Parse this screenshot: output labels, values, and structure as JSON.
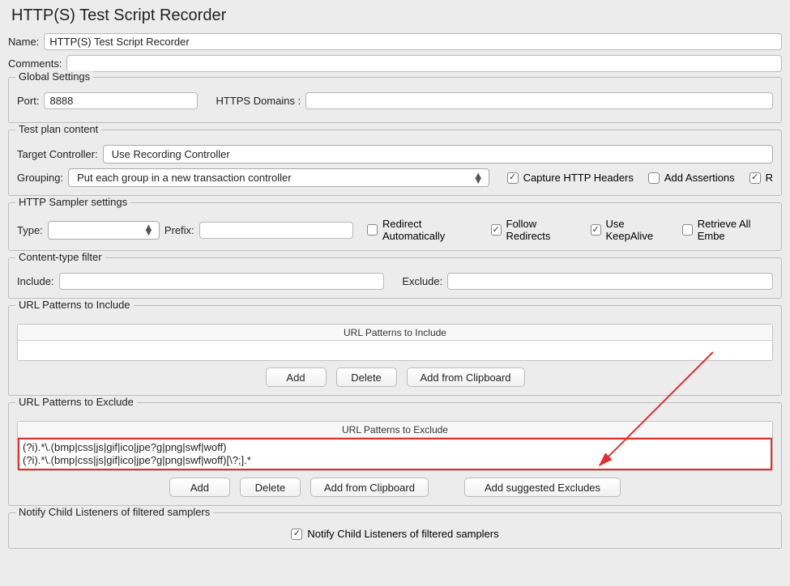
{
  "title": "HTTP(S) Test Script Recorder",
  "name_row": {
    "label": "Name:",
    "value": "HTTP(S) Test Script Recorder"
  },
  "comments_row": {
    "label": "Comments:",
    "value": ""
  },
  "global_settings": {
    "legend": "Global Settings",
    "port_label": "Port:",
    "port_value": "8888",
    "https_label": "HTTPS Domains :",
    "https_value": ""
  },
  "test_plan_content": {
    "legend": "Test plan content",
    "target_controller_label": "Target Controller:",
    "target_controller_value": "Use Recording Controller",
    "grouping_label": "Grouping:",
    "grouping_value": "Put each group in a new transaction controller",
    "capture_http_headers": {
      "label": "Capture HTTP Headers",
      "checked": true
    },
    "add_assertions": {
      "label": "Add Assertions",
      "checked": false
    },
    "last_partial": {
      "label": "R",
      "checked": true
    }
  },
  "http_sampler": {
    "legend": "HTTP Sampler settings",
    "type_label": "Type:",
    "type_value": "",
    "prefix_label": "Prefix:",
    "prefix_value": "",
    "redirect_auto": {
      "label": "Redirect Automatically",
      "checked": false
    },
    "follow_redirects": {
      "label": "Follow Redirects",
      "checked": true
    },
    "use_keepalive": {
      "label": "Use KeepAlive",
      "checked": true
    },
    "retrieve_embedded": {
      "label": "Retrieve All Embe",
      "checked": false
    }
  },
  "content_type_filter": {
    "legend": "Content-type filter",
    "include_label": "Include:",
    "include_value": "",
    "exclude_label": "Exclude:",
    "exclude_value": ""
  },
  "url_include": {
    "legend": "URL Patterns to Include",
    "header": "URL Patterns to Include",
    "buttons": {
      "add": "Add",
      "delete": "Delete",
      "clipboard": "Add from Clipboard"
    }
  },
  "url_exclude": {
    "legend": "URL Patterns to Exclude",
    "header": "URL Patterns to Exclude",
    "rows": [
      "(?i).*\\.(bmp|css|js|gif|ico|jpe?g|png|swf|woff)",
      "(?i).*\\.(bmp|css|js|gif|ico|jpe?g|png|swf|woff)[\\?;].*"
    ],
    "buttons": {
      "add": "Add",
      "delete": "Delete",
      "clipboard": "Add from Clipboard",
      "suggested": "Add suggested Excludes"
    }
  },
  "notify": {
    "legend": "Notify Child Listeners of filtered samplers",
    "checkbox": {
      "label": "Notify Child Listeners of filtered samplers",
      "checked": true
    }
  }
}
